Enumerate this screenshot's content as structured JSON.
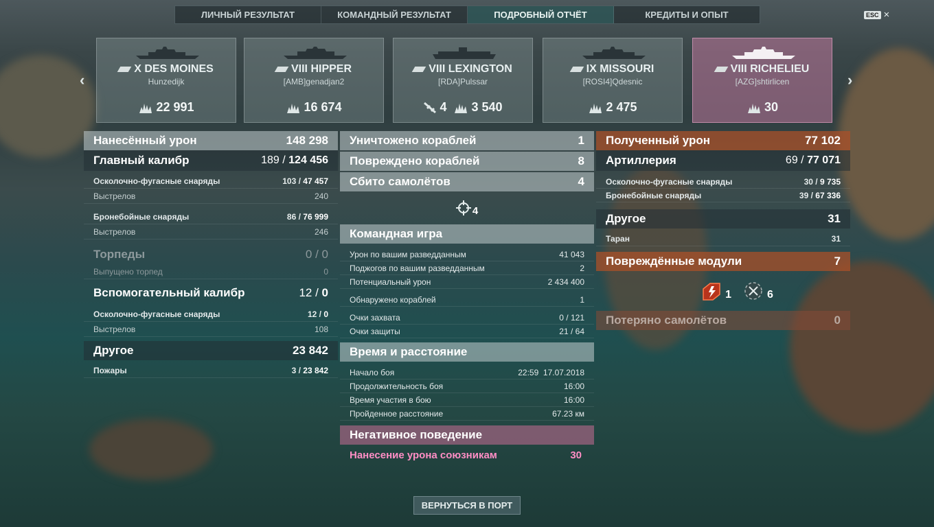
{
  "tabs": [
    "ЛИЧНЫЙ РЕЗУЛЬТАТ",
    "КОМАНДНЫЙ РЕЗУЛЬТАТ",
    "ПОДРОБНЫЙ ОТЧЁТ",
    "КРЕДИТЫ И ОПЫТ"
  ],
  "esc": {
    "key": "ESC",
    "close": "×"
  },
  "cards": [
    {
      "name": "X DES MOINES",
      "player": "Hunzedijk",
      "damage": "22 991",
      "planes": ""
    },
    {
      "name": "VIII HIPPER",
      "player": "[AMB]genadjan2",
      "damage": "16 674",
      "planes": ""
    },
    {
      "name": "VIII LEXINGTON",
      "player": "[RDA]Pulssar",
      "damage": "3 540",
      "planes": "4"
    },
    {
      "name": "IX MISSOURI",
      "player": "[ROSI4]Qdesnic",
      "damage": "2 475",
      "planes": ""
    },
    {
      "name": "VIII RICHELIEU",
      "player": "[AZG]shtirlicen",
      "damage": "30",
      "planes": ""
    }
  ],
  "left": {
    "dealt": {
      "label": "Нанесённый урон",
      "value": "148 298"
    },
    "main": {
      "label": "Главный калибр",
      "hits": "189",
      "dmg": "124 456"
    },
    "he": {
      "label": "Осколочно-фугасные снаряды",
      "hits": "103",
      "dmg": "47 457"
    },
    "he_shots": {
      "label": "Выстрелов",
      "value": "240"
    },
    "ap": {
      "label": "Бронебойные снаряды",
      "hits": "86",
      "dmg": "76 999"
    },
    "ap_shots": {
      "label": "Выстрелов",
      "value": "246"
    },
    "torp": {
      "label": "Торпеды",
      "hits": "0",
      "dmg": "0"
    },
    "torp_fired": {
      "label": "Выпущено торпед",
      "value": "0"
    },
    "secondary": {
      "label": "Вспомогательный калибр",
      "hits": "12",
      "dmg": "0"
    },
    "sec_he": {
      "label": "Осколочно-фугасные снаряды",
      "hits": "12",
      "dmg": "0"
    },
    "sec_shots": {
      "label": "Выстрелов",
      "value": "108"
    },
    "other": {
      "label": "Другое",
      "value": "23 842"
    },
    "fires": {
      "label": "Пожары",
      "hits": "3",
      "dmg": "23 842"
    }
  },
  "mid": {
    "destroyed": {
      "label": "Уничтожено кораблей",
      "value": "1"
    },
    "damaged": {
      "label": "Повреждено кораблей",
      "value": "8"
    },
    "planes": {
      "label": "Сбито самолётов",
      "value": "4"
    },
    "plane_icon_count": "4",
    "team": {
      "label": "Командная игра"
    },
    "spot_dmg": {
      "label": "Урон по вашим разведданным",
      "value": "41 043"
    },
    "spot_fires": {
      "label": "Поджогов по вашим разведданным",
      "value": "2"
    },
    "potential": {
      "label": "Потенциальный урон",
      "value": "2 434 400"
    },
    "detected": {
      "label": "Обнаружено кораблей",
      "value": "1"
    },
    "capture": {
      "label": "Очки захвата",
      "value": "0 / 121"
    },
    "defense": {
      "label": "Очки защиты",
      "value": "21 / 64"
    },
    "time": {
      "label": "Время и расстояние"
    },
    "start": {
      "label": "Начало боя",
      "value": "22:59  17.07.2018"
    },
    "duration": {
      "label": "Продолжительность боя",
      "value": "16:00"
    },
    "participation": {
      "label": "Время участия в бою",
      "value": "16:00"
    },
    "distance": {
      "label": "Пройденное расстояние",
      "value": "67.23 км"
    },
    "negative": {
      "label": "Негативное поведение"
    },
    "team_damage": {
      "label": "Нанесение урона союзникам",
      "value": "30"
    }
  },
  "right": {
    "received": {
      "label": "Полученный урон",
      "value": "77 102"
    },
    "artillery": {
      "label": "Артиллерия",
      "hits": "69",
      "dmg": "77 071"
    },
    "he": {
      "label": "Осколочно-фугасные снаряды",
      "hits": "30",
      "dmg": "9 735"
    },
    "ap": {
      "label": "Бронебойные снаряды",
      "hits": "39",
      "dmg": "67 336"
    },
    "other": {
      "label": "Другое",
      "value": "31"
    },
    "ram": {
      "label": "Таран",
      "value": "31"
    },
    "modules": {
      "label": "Повреждённые модули",
      "value": "7"
    },
    "module_a": "1",
    "module_b": "6",
    "lost_planes": {
      "label": "Потеряно самолётов",
      "value": "0"
    }
  },
  "back_button": "ВЕРНУТЬСЯ В ПОРТ"
}
